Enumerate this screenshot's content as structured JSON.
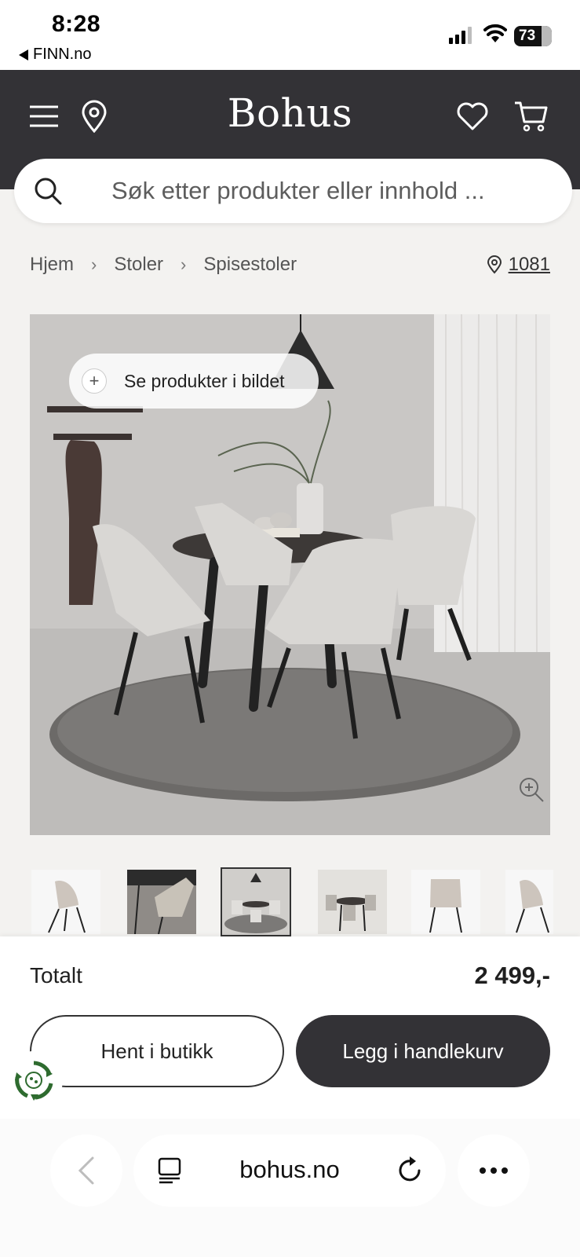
{
  "status_bar": {
    "time": "8:28",
    "back_app": "FINN.no",
    "battery": "73",
    "battery_level": 0.73
  },
  "header": {
    "logo": "Bohus",
    "icons": [
      "menu-icon",
      "location-pin-icon",
      "heart-icon",
      "cart-icon"
    ]
  },
  "search": {
    "placeholder": "Søk etter produkter eller innhold ..."
  },
  "breadcrumb": {
    "items": [
      "Hjem",
      "Stoler",
      "Spisestoler"
    ],
    "postal_code": "1081"
  },
  "hero": {
    "see_products_label": "Se produkter i bildet"
  },
  "thumbnails": {
    "count": 6,
    "active_index": 2
  },
  "cart_panel": {
    "total_label": "Totalt",
    "total_price": "2 499,-",
    "pickup_button": "Hent i butikk",
    "add_to_cart_button": "Legg i handlekurv"
  },
  "browser": {
    "url": "bohus.no"
  },
  "colors": {
    "header_bg": "#333236",
    "page_bg": "#f3f2f0",
    "primary_button": "#333236",
    "eco_badge": "#2e6b2f"
  }
}
